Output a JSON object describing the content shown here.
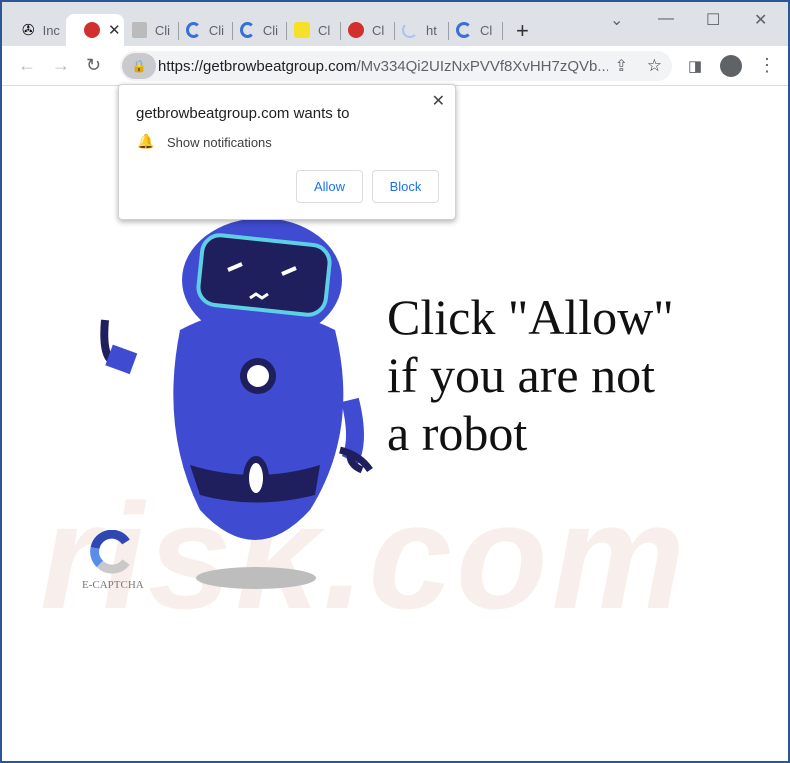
{
  "tabs": [
    {
      "label": "Inc",
      "icon": "film-reel-icon"
    },
    {
      "label": "",
      "icon": "red-circle-icon",
      "active": true
    },
    {
      "label": "Cli",
      "icon": "robot-icon"
    },
    {
      "label": "Cli",
      "icon": "captcha-icon"
    },
    {
      "label": "Cli",
      "icon": "captcha-icon"
    },
    {
      "label": "Cl",
      "icon": "yellow-lock-icon"
    },
    {
      "label": "Cl",
      "icon": "red-circle-icon"
    },
    {
      "label": "ht",
      "icon": "loading-icon"
    },
    {
      "label": "Cl",
      "icon": "captcha-icon"
    }
  ],
  "address": {
    "domain": "https://getbrowbeatgroup.com",
    "path": "/Mv334Qi2UIzNxPVVf8XvHH7zQVb..."
  },
  "popup": {
    "title": "getbrowbeatgroup.com wants to",
    "permission": "Show notifications",
    "allow": "Allow",
    "block": "Block"
  },
  "page": {
    "line1": "Click \"Allow\"",
    "line2": "if you are not",
    "line3": "a robot",
    "logo_text": "E-CAPTCHA",
    "watermark": "risk.com"
  },
  "colors": {
    "frame": "#2b5797",
    "robot": "#3f4bd1",
    "button_text": "#1a73e8"
  }
}
